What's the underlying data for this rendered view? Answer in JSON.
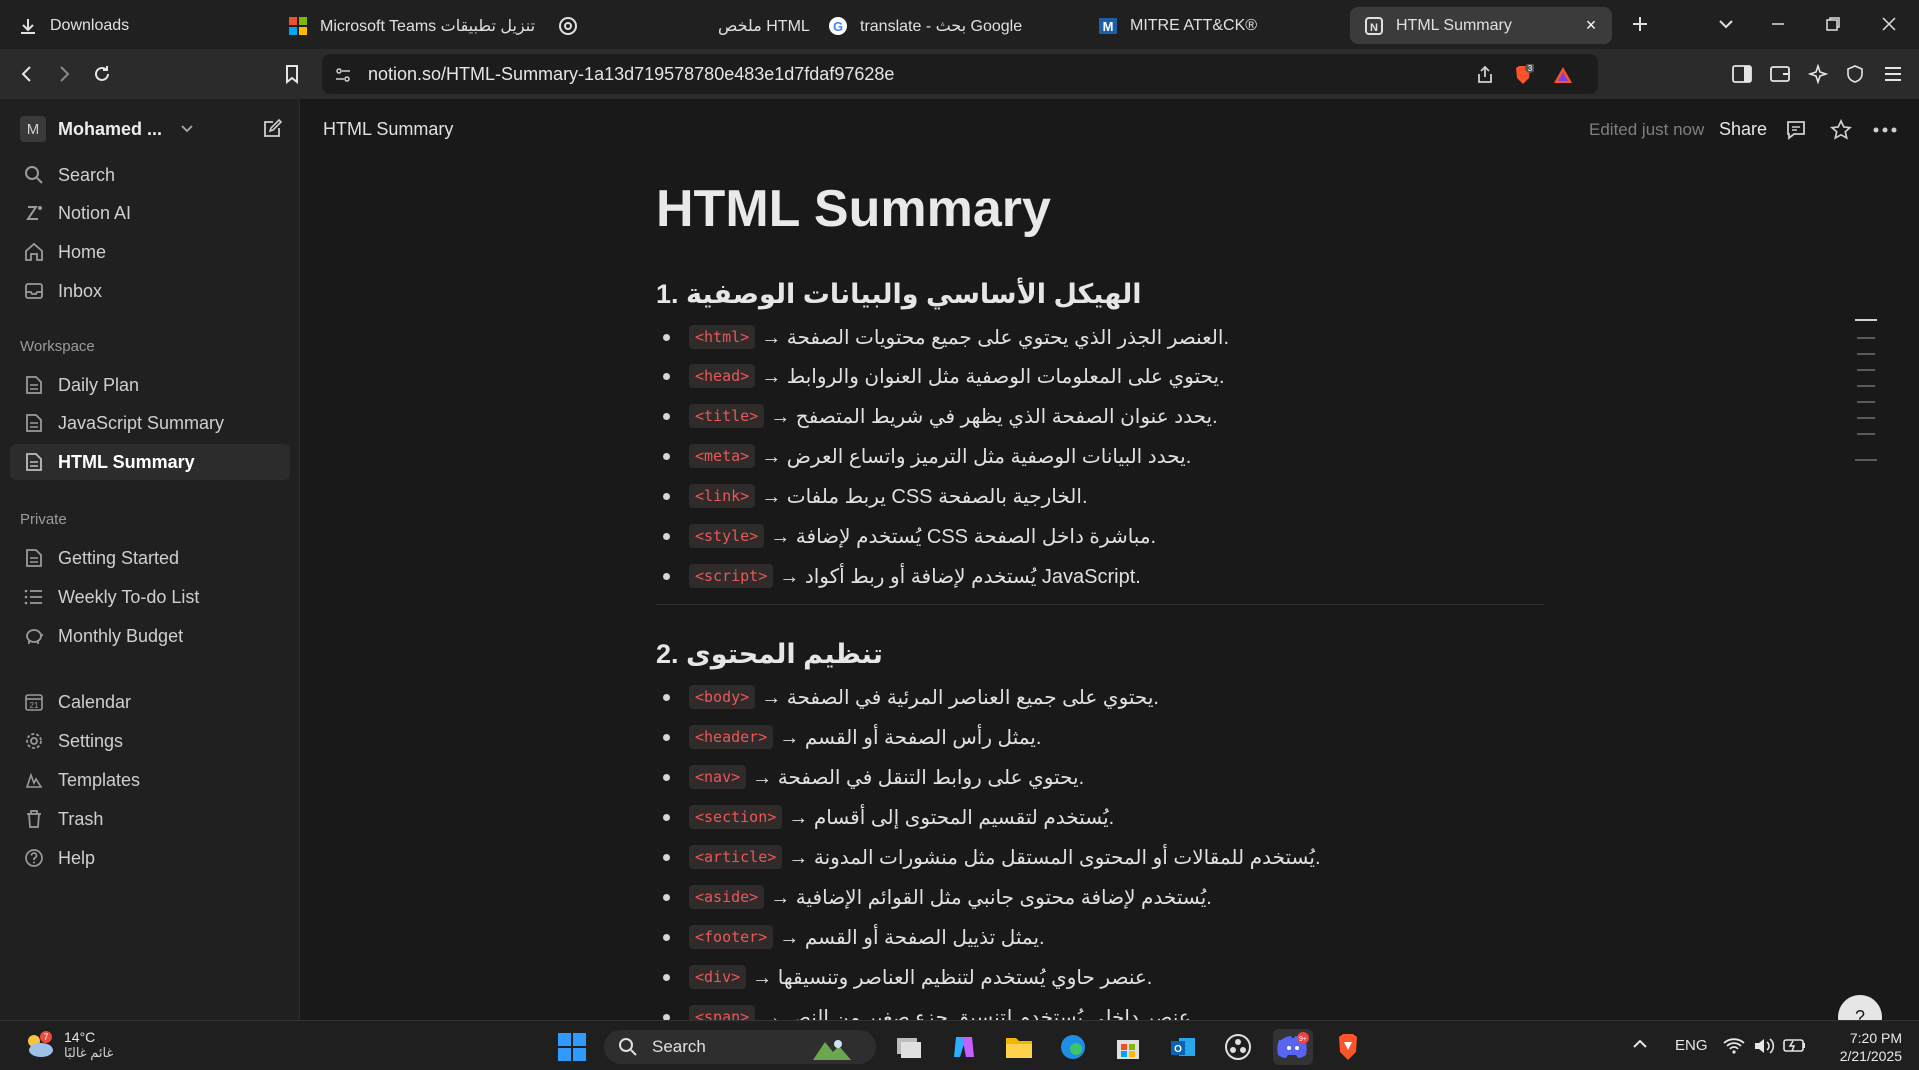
{
  "browser": {
    "tabs": [
      {
        "label": "Downloads"
      },
      {
        "label": "Microsoft Teams تنزيل تطبيقات"
      },
      {
        "label": "ملخص HTML"
      },
      {
        "label": "translate - بحث Google"
      },
      {
        "label": "MITRE ATT&CK®"
      },
      {
        "label": "HTML Summary"
      }
    ],
    "url": "notion.so/HTML-Summary-1a13d719578780e483e1d7fdaf97628e",
    "brave_badge": "3"
  },
  "sidebar": {
    "workspace_avatar": "M",
    "workspace_name": "Mohamed ...",
    "top_items": [
      {
        "label": "Search",
        "icon": "search-icon"
      },
      {
        "label": "Notion AI",
        "icon": "notion-ai-icon"
      },
      {
        "label": "Home",
        "icon": "home-icon"
      },
      {
        "label": "Inbox",
        "icon": "inbox-icon"
      }
    ],
    "workspace_label": "Workspace",
    "workspace_items": [
      {
        "label": "Daily Plan"
      },
      {
        "label": "JavaScript Summary"
      },
      {
        "label": "HTML Summary",
        "active": true
      }
    ],
    "private_label": "Private",
    "private_items": [
      {
        "label": "Getting Started"
      },
      {
        "label": "Weekly To-do List"
      },
      {
        "label": "Monthly Budget"
      }
    ],
    "bottom_items": [
      {
        "label": "Calendar"
      },
      {
        "label": "Settings"
      },
      {
        "label": "Templates"
      },
      {
        "label": "Trash"
      },
      {
        "label": "Help"
      }
    ],
    "calendar_day": "21"
  },
  "topbar": {
    "breadcrumb": "HTML Summary",
    "edited": "Edited just now",
    "share": "Share"
  },
  "page": {
    "title": "HTML Summary",
    "section1": {
      "heading": "1. الهيكل الأساسي والبيانات الوصفية",
      "items": [
        {
          "tag": "<html>",
          "text": "→ العنصر الجذر الذي يحتوي على جميع محتويات الصفحة."
        },
        {
          "tag": "<head>",
          "text": "→ يحتوي على المعلومات الوصفية مثل العنوان والروابط."
        },
        {
          "tag": "<title>",
          "text": "→ يحدد عنوان الصفحة الذي يظهر في شريط المتصفح."
        },
        {
          "tag": "<meta>",
          "text": "→ يحدد البيانات الوصفية مثل الترميز واتساع العرض."
        },
        {
          "tag": "<link>",
          "text": "→ يربط ملفات CSS الخارجية بالصفحة."
        },
        {
          "tag": "<style>",
          "text": "→ يُستخدم لإضافة CSS مباشرة داخل الصفحة."
        },
        {
          "tag": "<script>",
          "text": "→ يُستخدم لإضافة أو ربط أكواد JavaScript."
        }
      ]
    },
    "section2": {
      "heading": "2. تنظيم المحتوى",
      "items": [
        {
          "tag": "<body>",
          "text": "→ يحتوي على جميع العناصر المرئية في الصفحة."
        },
        {
          "tag": "<header>",
          "text": "→ يمثل رأس الصفحة أو القسم."
        },
        {
          "tag": "<nav>",
          "text": "→ يحتوي على روابط التنقل في الصفحة."
        },
        {
          "tag": "<section>",
          "text": "→ يُستخدم لتقسيم المحتوى إلى أقسام."
        },
        {
          "tag": "<article>",
          "text": "→ يُستخدم للمقالات أو المحتوى المستقل مثل منشورات المدونة."
        },
        {
          "tag": "<aside>",
          "text": "→ يُستخدم لإضافة محتوى جانبي مثل القوائم الإضافية."
        },
        {
          "tag": "<footer>",
          "text": "→ يمثل تذييل الصفحة أو القسم."
        },
        {
          "tag": "<div>",
          "text": "→ عنصر حاوي يُستخدم لتنظيم العناصر وتنسيقها."
        },
        {
          "tag": "<span>",
          "text": "→ عنصر داخلي يُستخدم لتنسيق جزء صغير من النص."
        }
      ]
    }
  },
  "taskbar": {
    "weather_temp": "14°C",
    "weather_cond": "غائم غالبًا",
    "weather_badge": "7",
    "search": "Search",
    "discord_badge": "9+",
    "lang": "ENG",
    "time": "7:20 PM",
    "date": "2/21/2025"
  },
  "colors": {
    "accent_code": "#eb5757",
    "brave": "#fb542b"
  }
}
